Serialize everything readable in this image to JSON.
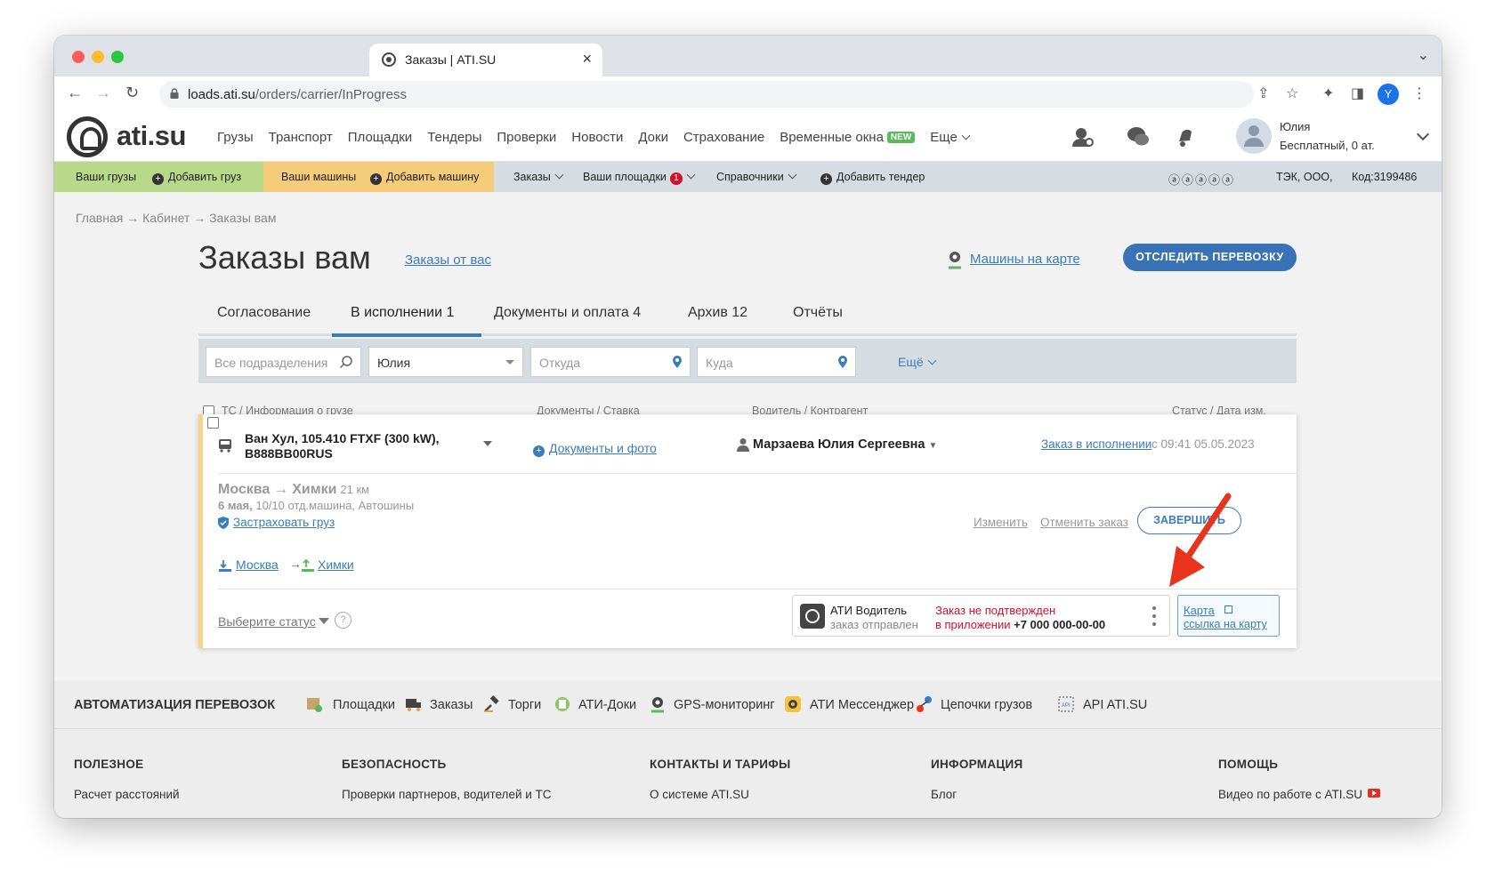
{
  "browser": {
    "tab_title": "Заказы | ATI.SU",
    "url_domain": "loads.ati.su",
    "url_path": "/orders/carrier/InProgress",
    "profile_initial": "Y"
  },
  "header": {
    "logo_text": "ati.su",
    "nav": [
      {
        "label": "Грузы"
      },
      {
        "label": "Транспорт"
      },
      {
        "label": "Площадки"
      },
      {
        "label": "Тендеры"
      },
      {
        "label": "Проверки"
      },
      {
        "label": "Новости"
      },
      {
        "label": "Доки"
      },
      {
        "label": "Страхование"
      },
      {
        "label": "Временные окна",
        "badge": "NEW"
      },
      {
        "label": "Еще"
      }
    ],
    "user": {
      "name": "Юлия",
      "plan": "Бесплатный,  0 ат."
    }
  },
  "subnav": {
    "your_cargo": "Ваши грузы",
    "add_cargo": "Добавить груз",
    "your_cars": "Ваши машины",
    "add_car": "Добавить машину",
    "orders": "Заказы",
    "your_platforms": "Ваши площадки",
    "platforms_count": "1",
    "directories": "Справочники",
    "add_tender": "Добавить тендер",
    "rating": "ⓐⓐⓐⓐⓐ",
    "company": "ТЭК, ООО,",
    "code": "Код:3199486"
  },
  "page": {
    "breadcrumb": "Главная → Кабинет → Заказы вам",
    "title": "Заказы вам",
    "orders_from_you": "Заказы от вас",
    "cars_on_map": "Машины на карте",
    "track_button": "ОТСЛЕДИТЬ ПЕРЕВОЗКУ"
  },
  "tabs": [
    {
      "label": "Согласование"
    },
    {
      "label": "В исполнении 1"
    },
    {
      "label": "Документы и оплата 4"
    },
    {
      "label": "Архив 12"
    },
    {
      "label": "Отчёты"
    }
  ],
  "filters": {
    "departments_placeholder": "Все подразделения",
    "user_value": "Юлия",
    "from_placeholder": "Откуда",
    "to_placeholder": "Куда",
    "more": "Ещё"
  },
  "columns": {
    "vehicle": "ТС / Информация о грузе",
    "docs": "Документы / Ставка",
    "driver": "Водитель / Контрагент",
    "status": "Статус / Дата изм."
  },
  "order": {
    "vehicle_line1": "Ван Хул, 105.410 FTXF (300 kW),",
    "vehicle_line2": "В888ВВ00RUS",
    "docs_link": "Документы и фото",
    "driver": "Марзаева Юлия Сергеевна",
    "status_link": "Заказ в исполнении",
    "status_date": "с 09:41 05.05.2023",
    "route_from": "Москва",
    "route_to": "Химки",
    "route_km": "21 км",
    "cargo_date": "6 мая,",
    "cargo_details": "10/10 отд.машина, Автошины",
    "insure_link": "Застраховать груз",
    "change": "Изменить",
    "cancel": "Отменить заказ",
    "finish": "ЗАВЕРШИТЬ",
    "point_from": "Москва",
    "point_to": "Химки",
    "choose_status": "Выберите статус",
    "ati_driver_name": "АТИ Водитель",
    "ati_driver_sent": "заказ отправлен",
    "ati_warning1": "Заказ не подтвержден",
    "ati_warning2": "в приложении",
    "ati_phone": "+7 000 000-00-00",
    "map_title": "Карта",
    "map_link": "ссылка на карту"
  },
  "footer": {
    "automation_title": "АВТОМАТИЗАЦИЯ ПЕРЕВОЗОК",
    "automation_items": [
      {
        "label": "Площадки"
      },
      {
        "label": "Заказы"
      },
      {
        "label": "Торги"
      },
      {
        "label": "АТИ-Доки"
      },
      {
        "label": "GPS-мониторинг"
      },
      {
        "label": "АТИ Мессенджер"
      },
      {
        "label": "Цепочки грузов"
      },
      {
        "label": "API ATI.SU"
      }
    ],
    "columns": [
      {
        "heading": "ПОЛЕЗНОЕ",
        "first_link": "Расчет расстояний"
      },
      {
        "heading": "БЕЗОПАСНОСТЬ",
        "first_link": "Проверки партнеров, водителей и ТС"
      },
      {
        "heading": "КОНТАКТЫ И ТАРИФЫ",
        "first_link": "О системе ATI.SU"
      },
      {
        "heading": "ИНФОРМАЦИЯ",
        "first_link": "Блог"
      },
      {
        "heading": "ПОМОЩЬ",
        "first_link": "Видео по работе с ATI.SU"
      }
    ]
  },
  "colors": {
    "accent": "#3a7dbd",
    "primary_button": "#3a72b8",
    "cargo_green": "#b8d98a",
    "cars_yellow": "#f4cc7a",
    "alert_red": "#d0112b",
    "annotation_arrow": "#e8341c"
  }
}
